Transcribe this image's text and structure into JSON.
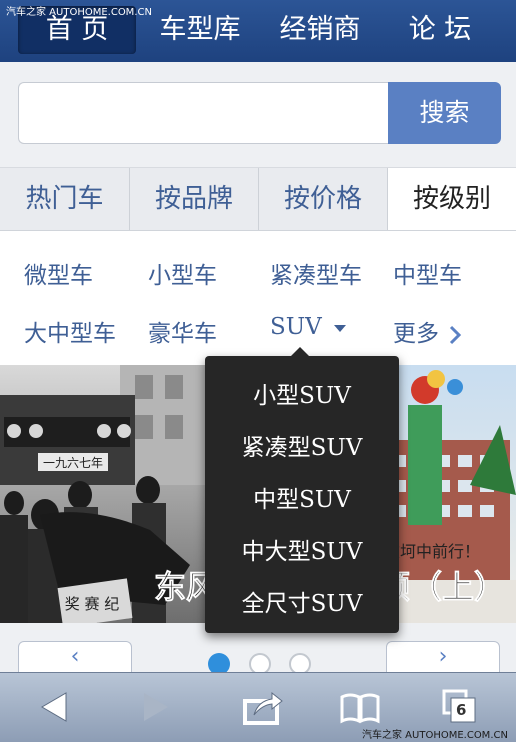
{
  "watermark_top": "汽车之家  AUTOHOME.COM.CN",
  "watermark_bottom": "汽车之家  AUTOHOME.COM.CN",
  "nav": {
    "items": [
      "首 页",
      "车型库",
      "经销商",
      "论 坛"
    ],
    "active": 0
  },
  "search": {
    "button_label": "搜索",
    "placeholder": ""
  },
  "tabs": {
    "items": [
      "热门车",
      "按品牌",
      "按价格",
      "按级别"
    ],
    "active": 3
  },
  "categories": {
    "row1": [
      "微型车",
      "小型车",
      "紧凑型车",
      "中型车"
    ],
    "row2": [
      "大中型车",
      "豪华车",
      "SUV",
      "更多"
    ]
  },
  "dropdown": {
    "items": [
      "小型SUV",
      "紧凑型SUV",
      "中型SUV",
      "中大型SUV",
      "全尺寸SUV"
    ]
  },
  "banner": {
    "headline": "东风品牌历史回顾（上）",
    "slogan": "坎坷中前行！",
    "plate": "一九六七年",
    "flag_text": "奖 赛 纪"
  },
  "pager": {
    "prev": "‹",
    "next": "›",
    "dots": 3,
    "active_dot": 0
  },
  "toolbar": {
    "tab_count": "6"
  },
  "colors": {
    "nav_bg": "#1e427f",
    "link": "#3f5f95",
    "button": "#5a80c3",
    "dot_active": "#2f8fdc"
  }
}
